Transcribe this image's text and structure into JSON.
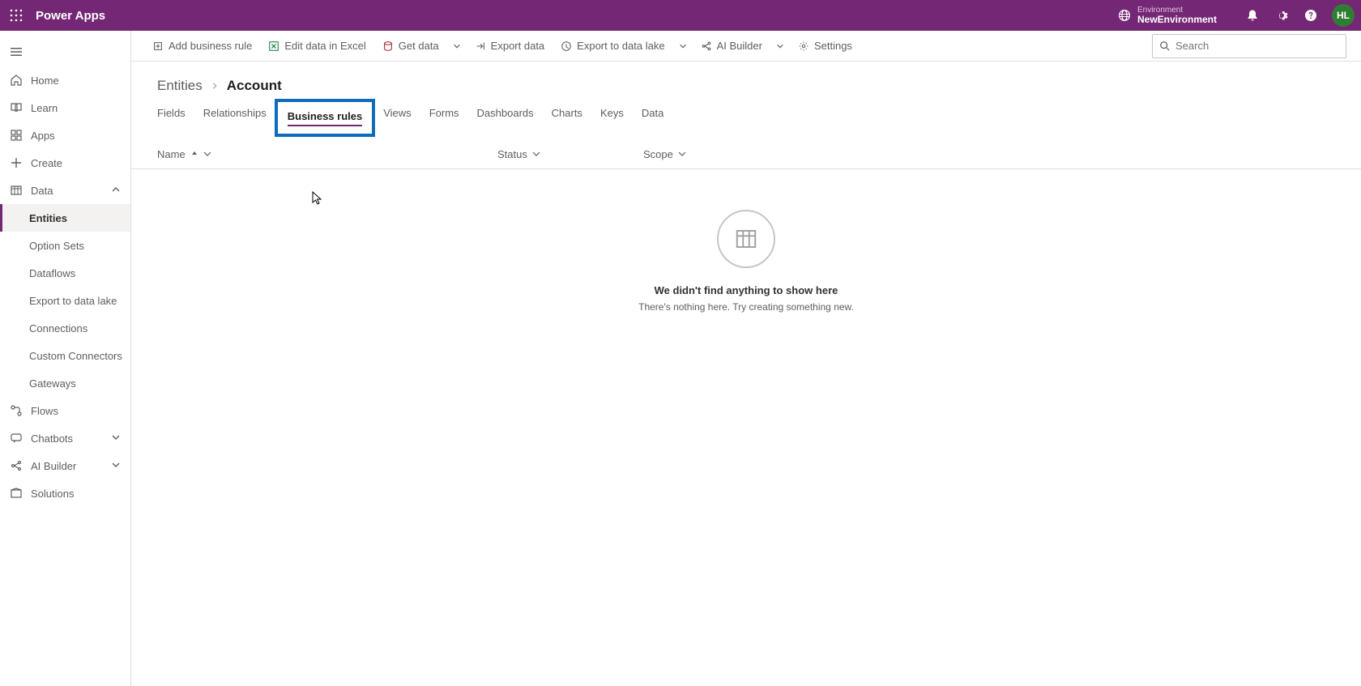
{
  "header": {
    "app_title": "Power Apps",
    "environment_label": "Environment",
    "environment_name": "NewEnvironment",
    "avatar_initials": "HL"
  },
  "sidebar": {
    "items": [
      {
        "id": "home",
        "label": "Home"
      },
      {
        "id": "learn",
        "label": "Learn"
      },
      {
        "id": "apps",
        "label": "Apps"
      },
      {
        "id": "create",
        "label": "Create"
      },
      {
        "id": "data",
        "label": "Data",
        "expanded": true
      },
      {
        "id": "flows",
        "label": "Flows"
      },
      {
        "id": "chatbots",
        "label": "Chatbots",
        "expandable": true
      },
      {
        "id": "ai-builder",
        "label": "AI Builder",
        "expandable": true
      },
      {
        "id": "solutions",
        "label": "Solutions"
      }
    ],
    "data_subitems": [
      {
        "id": "entities",
        "label": "Entities",
        "active": true
      },
      {
        "id": "option-sets",
        "label": "Option Sets"
      },
      {
        "id": "dataflows",
        "label": "Dataflows"
      },
      {
        "id": "export-lake",
        "label": "Export to data lake"
      },
      {
        "id": "connections",
        "label": "Connections"
      },
      {
        "id": "custom-connectors",
        "label": "Custom Connectors"
      },
      {
        "id": "gateways",
        "label": "Gateways"
      }
    ]
  },
  "commandbar": {
    "add_rule": "Add business rule",
    "edit_excel": "Edit data in Excel",
    "get_data": "Get data",
    "export_data": "Export data",
    "export_lake": "Export to data lake",
    "ai_builder": "AI Builder",
    "settings": "Settings",
    "search_placeholder": "Search"
  },
  "breadcrumb": {
    "parent": "Entities",
    "current": "Account"
  },
  "tabs": [
    {
      "id": "fields",
      "label": "Fields"
    },
    {
      "id": "relationships",
      "label": "Relationships"
    },
    {
      "id": "business-rules",
      "label": "Business rules",
      "active": true,
      "highlight": true
    },
    {
      "id": "views",
      "label": "Views"
    },
    {
      "id": "forms",
      "label": "Forms"
    },
    {
      "id": "dashboards",
      "label": "Dashboards"
    },
    {
      "id": "charts",
      "label": "Charts"
    },
    {
      "id": "keys",
      "label": "Keys"
    },
    {
      "id": "data",
      "label": "Data"
    }
  ],
  "columns": {
    "name": "Name",
    "status": "Status",
    "scope": "Scope"
  },
  "empty": {
    "title": "We didn't find anything to show here",
    "subtitle": "There's nothing here. Try creating something new."
  }
}
